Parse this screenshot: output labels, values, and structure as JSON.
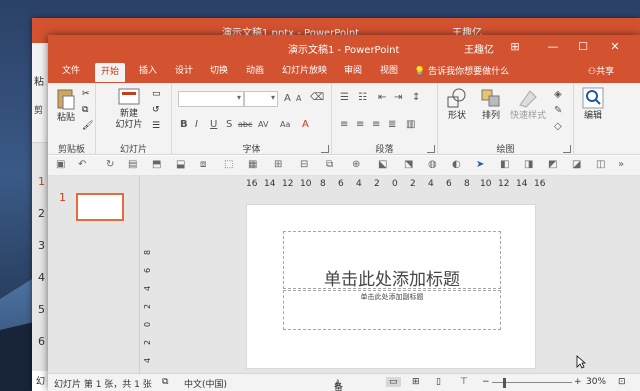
{
  "bg_window": {
    "title": "演示文稿1.pptx  -  PowerPoint",
    "user": "王趣亿",
    "ribbon_left": "粘",
    "ribbon_left2": "剪",
    "side_numbers": [
      "1",
      "2",
      "3",
      "4",
      "5",
      "6"
    ],
    "status_left": "幻"
  },
  "window": {
    "title": "演示文稿1  -  PowerPoint",
    "user": "王趣亿",
    "controls": {
      "ribbon_display": "⊞",
      "minimize": "—",
      "maximize": "☐",
      "close": "✕"
    }
  },
  "tabs": [
    "文件",
    "开始",
    "插入",
    "设计",
    "切换",
    "动画",
    "幻灯片放映",
    "审阅",
    "视图"
  ],
  "active_tab": "开始",
  "tell_me": "告诉我你想要做什么",
  "share": "共享",
  "groups": {
    "clipboard": {
      "label": "剪贴板",
      "paste": "粘贴"
    },
    "slides": {
      "label": "幻灯片",
      "new_slide": "新建",
      "new_slide2": "幻灯片"
    },
    "font": {
      "label": "字体",
      "bold": "B",
      "italic": "I",
      "underline": "U",
      "strike": "S",
      "shadow": "abc",
      "spacing": "AV",
      "case": "Aa"
    },
    "paragraph": {
      "label": "段落"
    },
    "drawing": {
      "label": "绘图",
      "shapes": "形状",
      "arrange": "排列",
      "quick_styles": "快速样式"
    },
    "editing": {
      "label": "编辑",
      "edit": "编辑"
    }
  },
  "slide_number": "1",
  "ruler_numbers": [
    "16",
    "14",
    "12",
    "10",
    "8",
    "6",
    "4",
    "2",
    "0",
    "2",
    "4",
    "6",
    "8",
    "10",
    "12",
    "14",
    "16"
  ],
  "vruler_numbers": [
    "8",
    "6",
    "4",
    "2",
    "0",
    "2",
    "4",
    "6",
    "8"
  ],
  "slide": {
    "title_placeholder": "单击此处添加标题",
    "subtitle_placeholder": "单击此处添加副标题"
  },
  "status": {
    "slide_info": "幻灯片 第 1 张，共 1 张",
    "language": "中文(中国)",
    "notes": "备注",
    "zoom": "30%"
  },
  "colors": {
    "accent": "#d35230",
    "accent_text": "#c43e1c"
  }
}
